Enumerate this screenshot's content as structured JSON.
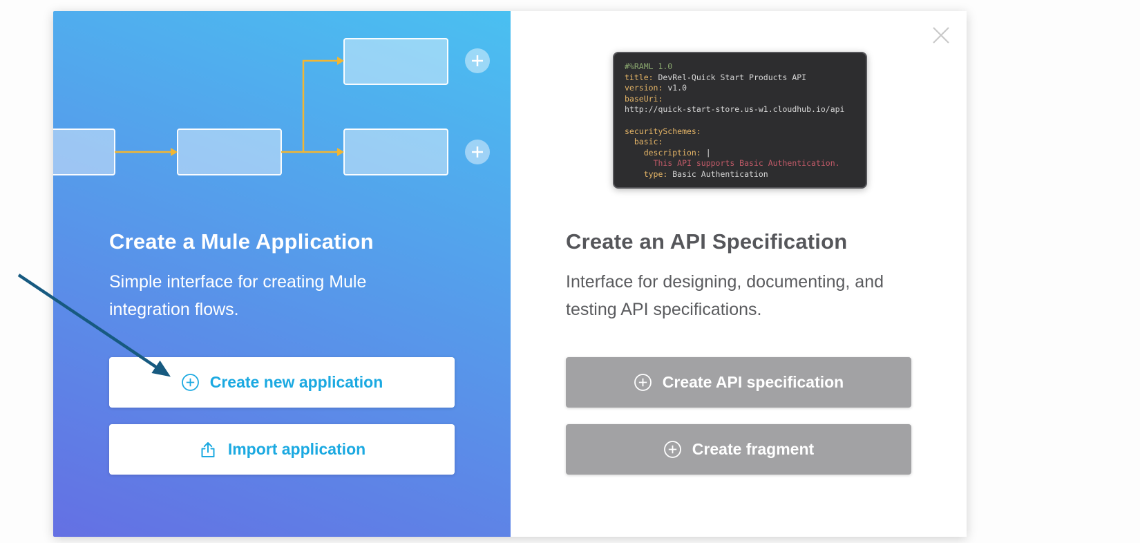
{
  "modal": {
    "close_icon": "x"
  },
  "left_panel": {
    "title": "Create a Mule Application",
    "description": "Simple interface for creating Mule integration flows.",
    "buttons": [
      {
        "label": "Create new application",
        "icon": "plus-circle"
      },
      {
        "label": "Import application",
        "icon": "upload"
      }
    ],
    "illustration": "flow-diagram-with-plus-nodes"
  },
  "right_panel": {
    "title": "Create an API Specification",
    "description": "Interface for designing, documenting, and testing API specifications.",
    "buttons": [
      {
        "label": "Create API specification",
        "icon": "plus-circle"
      },
      {
        "label": "Create fragment",
        "icon": "plus-circle"
      }
    ],
    "code_snippet": {
      "language": "RAML",
      "lines": [
        [
          {
            "t": "#%RAML 1.0",
            "c": "comment"
          }
        ],
        [
          {
            "t": "title:",
            "c": "key"
          },
          {
            "t": " DevRel-Quick Start Products API",
            "c": "plain"
          }
        ],
        [
          {
            "t": "version:",
            "c": "key"
          },
          {
            "t": " v1.0",
            "c": "plain"
          }
        ],
        [
          {
            "t": "baseUri:",
            "c": "key"
          }
        ],
        [
          {
            "t": "http://quick-start-store.us-w1.cloudhub.io/api",
            "c": "plain"
          }
        ],
        [],
        [
          {
            "t": "securitySchemes:",
            "c": "key"
          }
        ],
        [
          {
            "t": "  basic:",
            "c": "key"
          }
        ],
        [
          {
            "t": "    description:",
            "c": "key"
          },
          {
            "t": " |",
            "c": "plain"
          }
        ],
        [
          {
            "t": "      This API supports Basic Authentication.",
            "c": "string"
          }
        ],
        [
          {
            "t": "    type:",
            "c": "key"
          },
          {
            "t": " Basic Authentication",
            "c": "plain"
          }
        ]
      ]
    }
  },
  "colors": {
    "accent_blue": "#1ba9e1",
    "panel_gradient_top": "#4ac0f1",
    "panel_gradient_bottom": "#6470e3",
    "flow_arrow_yellow": "#f2b632",
    "annotation_arrow_navy": "#175a80",
    "gray_button": "#a2a2a4",
    "right_title_gray": "#55565a",
    "code_background": "#2d2d2f",
    "code_key": "#e5b567",
    "code_comment": "#8aa86f",
    "code_string": "#c25a68",
    "code_plain": "#d6d6d6",
    "close_icon_gray": "#c9c9c9"
  }
}
